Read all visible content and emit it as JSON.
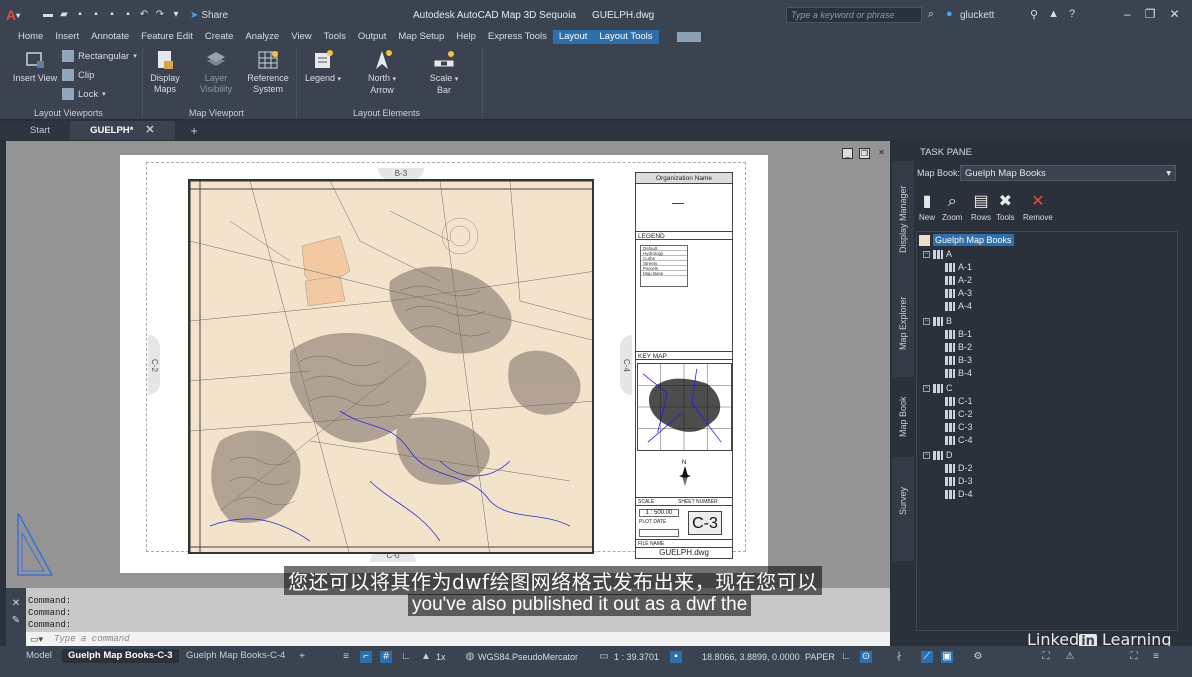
{
  "titlebar": {
    "logo": "A",
    "share_label": "Share",
    "app_title": "Autodesk AutoCAD Map 3D Sequoia",
    "doc_title": "GUELPH.dwg",
    "search_placeholder": "Type a keyword or phrase",
    "user_name": "gluckett"
  },
  "ribbon_tabs": [
    "Home",
    "Insert",
    "Annotate",
    "Feature Edit",
    "Create",
    "Analyze",
    "View",
    "Tools",
    "Output",
    "Map Setup",
    "Help",
    "Express Tools",
    "Layout",
    "Layout Tools"
  ],
  "ribbon": {
    "insert_view": "Insert View",
    "rectangular": "Rectangular",
    "clip": "Clip",
    "lock": "Lock",
    "panel_layout_viewports": "Layout Viewports",
    "display_maps_1": "Display",
    "display_maps_2": "Maps",
    "layer_visibility_1": "Layer",
    "layer_visibility_2": "Visibility",
    "reference_system_1": "Reference",
    "reference_system_2": "System",
    "panel_map_viewport": "Map Viewport",
    "legend": "Legend",
    "north_arrow_1": "North",
    "north_arrow_2": "Arrow",
    "scale_bar_1": "Scale",
    "scale_bar_2": "Bar",
    "panel_layout_elements": "Layout Elements"
  },
  "doc_tabs": {
    "start": "Start",
    "active": "GUELPH*"
  },
  "drawing": {
    "top_nav": "B-3",
    "bottom_nav": "C-0",
    "left_nav": "C-2",
    "right_nav": "C-4",
    "org_name": "Organization Name",
    "legend_title": "LEGEND",
    "legend_items": [
      "Default",
      "Hydrology",
      "Curbs",
      "Streets",
      "Parcels",
      "Map Base"
    ],
    "keymap_title": "KEY MAP",
    "scale_label": "SCALE",
    "sheet_number_label": "SHEET NUMBER",
    "scale_value": "1 : 500.00",
    "plot_date_label": "PLOT DATE",
    "file_name_label": "FILE NAME",
    "sheet_number": "C-3",
    "file_name": "GUELPH.dwg"
  },
  "taskpane": {
    "title": "TASK PANE",
    "map_book_label": "Map Book:",
    "map_book_value": "Guelph Map Books",
    "side_tabs": [
      "Display Manager",
      "Map Explorer",
      "Map Book",
      "Survey"
    ],
    "tools": [
      "New",
      "Zoom",
      "Rows",
      "Tools",
      "Remove"
    ],
    "tree_root": "Guelph Map Books",
    "groups": [
      {
        "name": "A",
        "sheets": [
          "A-1",
          "A-2",
          "A-3",
          "A-4"
        ]
      },
      {
        "name": "B",
        "sheets": [
          "B-1",
          "B-2",
          "B-3",
          "B-4"
        ]
      },
      {
        "name": "C",
        "sheets": [
          "C-1",
          "C-2",
          "C-3",
          "C-4"
        ]
      },
      {
        "name": "D",
        "sheets": [
          "D-2",
          "D-3",
          "D-4"
        ]
      }
    ]
  },
  "command": {
    "history": [
      "Command:",
      "Command:",
      "Command:"
    ],
    "placeholder": "Type a command"
  },
  "subtitles": {
    "chinese": "您还可以将其作为dwf绘图网络格式发布出来，现在您可以",
    "english": "you've also published it out as a dwf the"
  },
  "statusbar": {
    "model": "Model",
    "layout1": "Guelph Map Books-C-3",
    "layout2": "Guelph Map Books-C-4",
    "scale_factor": "1x",
    "coord_system": "WGS84.PseudoMercator",
    "map_scale": "1 : 39.3701",
    "coords": "18.8066, 3.8899, 0.0000",
    "space": "PAPER"
  },
  "watermark": {
    "linked": "Linked",
    "in": "in",
    "learning": "Learning"
  }
}
